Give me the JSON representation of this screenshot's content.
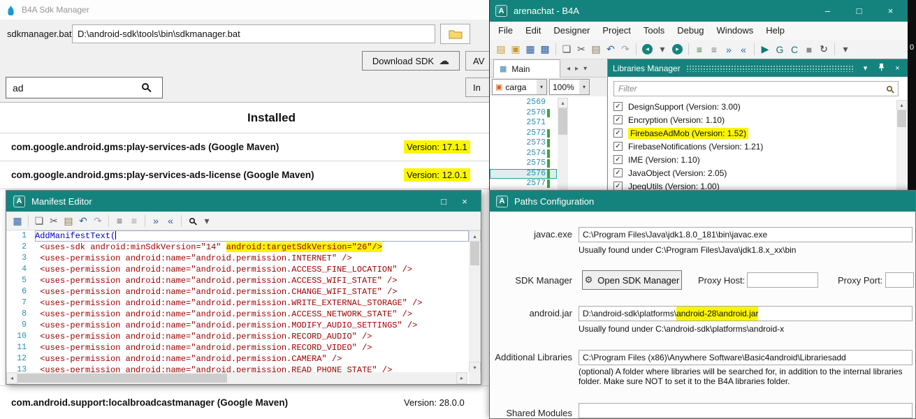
{
  "colors": {
    "teal": "#15837d",
    "highlight": "#fbf500",
    "line_number": "#2b91af",
    "xml": "#a00000",
    "keyword": "#0000c0"
  },
  "glyphs": {
    "check": "✓",
    "dropdown": "▾",
    "cloud": "☁",
    "gear": "⚙",
    "minimize": "–",
    "maximize": "□",
    "close": "×",
    "up": "▴",
    "down": "▾",
    "left": "◂",
    "right": "▸"
  },
  "side_strip": {
    "label": "0"
  },
  "sdk_manager": {
    "window_title": "B4A Sdk Manager",
    "path_label": "sdkmanager.bat:",
    "path_value": "D:\\android-sdk\\tools\\bin\\sdkmanager.bat",
    "download_sdk_label": "Download SDK",
    "clipped_button_1": "AV",
    "clipped_button_2": "In",
    "search_value": "ad",
    "installed_heading": "Installed",
    "packages": [
      {
        "name": "com.google.android.gms:play-services-ads (Google Maven)",
        "version": "Version: 17.1.1",
        "highlighted": true
      },
      {
        "name": "com.google.android.gms:play-services-ads-license (Google Maven)",
        "version": "Version: 12.0.1",
        "highlighted": true
      }
    ],
    "bottom_package": {
      "name": "com.android.support:localbroadcastmanager (Google Maven)",
      "version": "Version: 28.0.0"
    }
  },
  "ide": {
    "window_title": "arenachat - B4A",
    "menu_items": [
      "File",
      "Edit",
      "Designer",
      "Project",
      "Tools",
      "Debug",
      "Windows",
      "Help"
    ],
    "active_tab": "Main",
    "member_combo": "carga",
    "zoom_combo": "100%",
    "tab_arrows": [
      {
        "name": "tab-scroll-left-icon",
        "glyph": "◂"
      },
      {
        "name": "tab-scroll-right-icon",
        "glyph": "▸"
      },
      {
        "name": "tab-list-icon",
        "glyph": "▾"
      }
    ],
    "toolbar_icons": [
      {
        "name": "new-project-icon",
        "glyph": "▤",
        "color": "#c79a2e"
      },
      {
        "name": "open-project-icon",
        "glyph": "▣",
        "color": "#c79a2e"
      },
      {
        "name": "save-icon",
        "glyph": "▦",
        "color": "#2b5fa3"
      },
      {
        "name": "save-all-icon",
        "glyph": "▩",
        "color": "#2b5fa3"
      },
      {
        "sep": true
      },
      {
        "name": "copy-icon",
        "glyph": "❏",
        "color": "#5a5a5a"
      },
      {
        "name": "cut-icon",
        "glyph": "✂",
        "color": "#5a5a5a"
      },
      {
        "name": "paste-icon",
        "glyph": "▤",
        "color": "#8a7550"
      },
      {
        "name": "undo-icon",
        "glyph": "↶",
        "color": "#2b5fa3"
      },
      {
        "name": "redo-icon",
        "glyph": "↷",
        "color": "#9aa4b0"
      },
      {
        "sep": true
      },
      {
        "name": "navigate-back-icon",
        "glyph": "◂",
        "circle": true
      },
      {
        "name": "back-history-icon",
        "glyph": "▾",
        "color": "#555555"
      },
      {
        "name": "navigate-forward-icon",
        "glyph": "▸",
        "circle": true
      },
      {
        "sep": true
      },
      {
        "name": "comment-icon",
        "glyph": "≡",
        "color": "#2e7d4f"
      },
      {
        "name": "uncomment-icon",
        "glyph": "≡",
        "color": "#777777"
      },
      {
        "name": "indent-icon",
        "glyph": "»",
        "color": "#2b5fa3"
      },
      {
        "name": "outdent-icon",
        "glyph": "«",
        "color": "#2b5fa3"
      },
      {
        "sep": true
      },
      {
        "name": "run-icon",
        "glyph": "▶",
        "color": "#0e7a74"
      },
      {
        "name": "rapid-debug-icon",
        "glyph": "G",
        "color": "#0e7a74"
      },
      {
        "name": "compile-icon",
        "glyph": "C",
        "color": "#0e7a74"
      },
      {
        "name": "stop-icon",
        "glyph": "■",
        "color": "#8a8a8a"
      },
      {
        "name": "refresh-icon",
        "glyph": "↻",
        "color": "#333333"
      },
      {
        "sep": true
      },
      {
        "name": "toolbar-overflow-icon",
        "glyph": "▾",
        "color": "#555555"
      }
    ],
    "editor_lines": [
      {
        "number": "2569",
        "changed": false,
        "current": false
      },
      {
        "number": "2570",
        "changed": true,
        "current": false
      },
      {
        "number": "2571",
        "changed": false,
        "current": false
      },
      {
        "number": "2572",
        "changed": true,
        "current": false
      },
      {
        "number": "2573",
        "changed": true,
        "current": false
      },
      {
        "number": "2574",
        "changed": true,
        "current": false
      },
      {
        "number": "2575",
        "changed": true,
        "current": false
      },
      {
        "number": "2576",
        "changed": true,
        "current": true
      },
      {
        "number": "2577",
        "changed": true,
        "current": false
      }
    ],
    "libraries_manager": {
      "header": "Libraries Manager",
      "filter_placeholder": "Filter",
      "libraries": [
        {
          "label": "DesignSupport (Version: 3.00)",
          "checked": true,
          "highlighted": false
        },
        {
          "label": "Encryption (Version: 1.10)",
          "checked": true,
          "highlighted": false
        },
        {
          "label": "FirebaseAdMob (Version: 1.52)",
          "checked": true,
          "highlighted": true
        },
        {
          "label": "FirebaseNotifications (Version: 1.21)",
          "checked": true,
          "highlighted": false
        },
        {
          "label": "IME (Version: 1.10)",
          "checked": true,
          "highlighted": false
        },
        {
          "label": "JavaObject (Version: 2.05)",
          "checked": true,
          "highlighted": false
        },
        {
          "label": "JpegUtils (Version: 1.00)",
          "checked": true,
          "highlighted": false
        }
      ]
    }
  },
  "manifest_editor": {
    "window_title": "Manifest Editor",
    "toolbar_icons": [
      {
        "name": "save-icon",
        "glyph": "▦",
        "color": "#2b5fa3"
      },
      {
        "sep": true
      },
      {
        "name": "copy-icon",
        "glyph": "❏",
        "color": "#5a5a5a"
      },
      {
        "name": "cut-icon",
        "glyph": "✂",
        "color": "#5a5a5a"
      },
      {
        "name": "paste-icon",
        "glyph": "▤",
        "color": "#8a7550"
      },
      {
        "name": "undo-icon",
        "glyph": "↶",
        "color": "#2b5fa3"
      },
      {
        "name": "redo-icon",
        "glyph": "↷",
        "color": "#9aa4b0"
      },
      {
        "sep": true
      },
      {
        "name": "comment-icon",
        "glyph": "≡",
        "color": "#555555"
      },
      {
        "name": "uncomment-icon",
        "glyph": "≡",
        "color": "#999999"
      },
      {
        "sep": true
      },
      {
        "name": "indent-icon",
        "glyph": "»",
        "color": "#2b5fa3"
      },
      {
        "name": "outdent-icon",
        "glyph": "«",
        "color": "#2b5fa3"
      },
      {
        "sep": true
      },
      {
        "name": "search-icon",
        "mag": true
      },
      {
        "name": "toolbar-overflow-icon",
        "glyph": "▾",
        "color": "#555555"
      }
    ],
    "code_lines": [
      {
        "number": "1",
        "current": true,
        "segments": [
          {
            "text": "AddManifestText(",
            "style": "keyword"
          }
        ]
      },
      {
        "number": "2",
        "segments": [
          {
            "text": " <uses-sdk android:minSdkVersion=\"14\" ",
            "style": "xml"
          },
          {
            "text": "android:targetSdkVersion=\"26\"/>",
            "style": "xml",
            "highlighted": true
          }
        ]
      },
      {
        "number": "3",
        "segments": [
          {
            "text": " <uses-permission android:name=\"android.permission.INTERNET\" />",
            "style": "xml"
          }
        ]
      },
      {
        "number": "4",
        "segments": [
          {
            "text": " <uses-permission android:name=\"android.permission.ACCESS_FINE_LOCATION\" />",
            "style": "xml"
          }
        ]
      },
      {
        "number": "5",
        "segments": [
          {
            "text": " <uses-permission android:name=\"android.permission.ACCESS_WIFI_STATE\" />",
            "style": "xml"
          }
        ]
      },
      {
        "number": "6",
        "segments": [
          {
            "text": " <uses-permission android:name=\"android.permission.CHANGE_WIFI_STATE\" />",
            "style": "xml"
          }
        ]
      },
      {
        "number": "7",
        "segments": [
          {
            "text": " <uses-permission android:name=\"android.permission.WRITE_EXTERNAL_STORAGE\" />",
            "style": "xml"
          }
        ]
      },
      {
        "number": "8",
        "segments": [
          {
            "text": " <uses-permission android:name=\"android.permission.ACCESS_NETWORK_STATE\" />",
            "style": "xml"
          }
        ]
      },
      {
        "number": "9",
        "segments": [
          {
            "text": " <uses-permission android:name=\"android.permission.MODIFY_AUDIO_SETTINGS\" />",
            "style": "xml"
          }
        ]
      },
      {
        "number": "10",
        "segments": [
          {
            "text": " <uses-permission android:name=\"android.permission.RECORD_AUDIO\" />",
            "style": "xml"
          }
        ]
      },
      {
        "number": "11",
        "segments": [
          {
            "text": " <uses-permission android:name=\"android.permission.RECORD_VIDEO\" />",
            "style": "xml"
          }
        ]
      },
      {
        "number": "12",
        "segments": [
          {
            "text": " <uses-permission android:name=\"android.permission.CAMERA\" />",
            "style": "xml"
          }
        ]
      },
      {
        "number": "13",
        "segments": [
          {
            "text": " <uses-permission android:name=\"android.permission.READ_PHONE_STATE\" />",
            "style": "xml"
          }
        ]
      }
    ]
  },
  "paths_config": {
    "window_title": "Paths Configuration",
    "javac": {
      "label": "javac.exe",
      "value": "C:\\Program Files\\Java\\jdk1.8.0_181\\bin\\javac.exe",
      "hint": "Usually found under C:\\Program Files\\Java\\jdk1.8.x_xx\\bin"
    },
    "sdk_manager_row": {
      "label": "SDK Manager",
      "button": "Open SDK Manager",
      "proxy_host_label": "Proxy Host:",
      "proxy_port_label": "Proxy Port:"
    },
    "android_jar": {
      "label": "android.jar",
      "value_prefix": "D:\\android-sdk\\platforms\\",
      "value_highlight": "android-28\\android.jar",
      "hint": "Usually found under C:\\android-sdk\\platforms\\android-x"
    },
    "additional_libraries": {
      "label": "Additional Libraries",
      "value": "C:\\Program Files (x86)\\Anywhere Software\\Basic4android\\Librariesadd",
      "hint": "(optional) A folder where libraries will be searched for, in addition to the internal libraries folder. Make sure NOT to set it to the B4A libraries folder."
    },
    "shared_modules": {
      "label": "Shared Modules"
    }
  }
}
